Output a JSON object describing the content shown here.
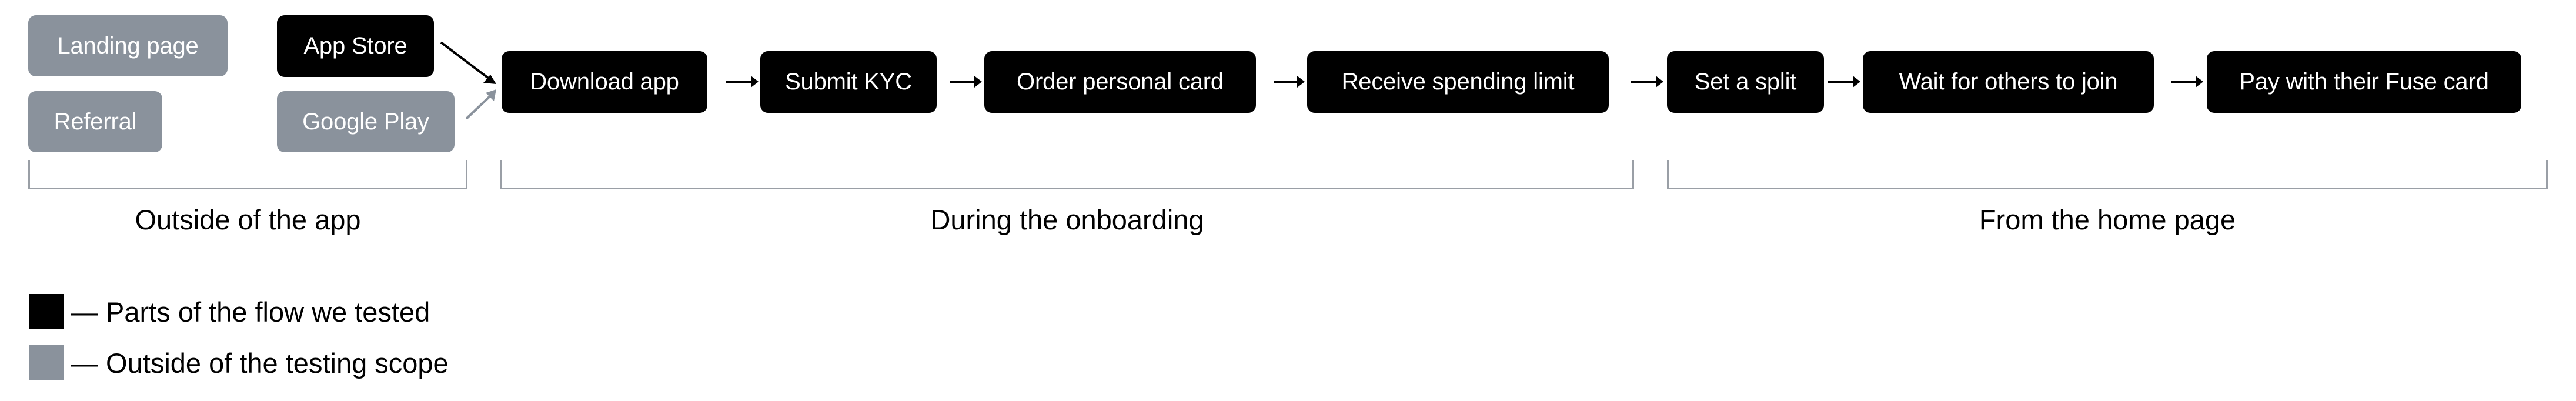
{
  "diagram": {
    "colors": {
      "tested": "#000000",
      "outside": "#8a929c",
      "bracket": "#9a9fa6",
      "text_on_node": "#ffffff"
    },
    "sources": {
      "entry_points": [
        {
          "label": "Landing page",
          "status": "outside"
        },
        {
          "label": "Referral",
          "status": "outside"
        }
      ],
      "stores": [
        {
          "label": "App Store",
          "status": "tested"
        },
        {
          "label": "Google Play",
          "status": "outside"
        }
      ]
    },
    "flow": [
      {
        "label": "Download app",
        "status": "tested"
      },
      {
        "label": "Submit KYC",
        "status": "tested"
      },
      {
        "label": "Order personal card",
        "status": "tested"
      },
      {
        "label": "Receive spending limit",
        "status": "tested"
      },
      {
        "label": "Set a split",
        "status": "tested"
      },
      {
        "label": "Wait for others to join",
        "status": "tested"
      },
      {
        "label": "Pay with their Fuse card",
        "status": "tested"
      }
    ],
    "connections": [
      {
        "from": "App Store",
        "to": "Download app",
        "status": "tested"
      },
      {
        "from": "Google Play",
        "to": "Download app",
        "status": "outside"
      },
      {
        "from": "Download app",
        "to": "Submit KYC",
        "status": "tested"
      },
      {
        "from": "Submit KYC",
        "to": "Order personal card",
        "status": "tested"
      },
      {
        "from": "Order personal card",
        "to": "Receive spending limit",
        "status": "tested"
      },
      {
        "from": "Receive spending limit",
        "to": "Set a split",
        "status": "tested"
      },
      {
        "from": "Set a split",
        "to": "Wait for others to join",
        "status": "tested"
      },
      {
        "from": "Wait for others to join",
        "to": "Pay with their Fuse card",
        "status": "tested"
      }
    ],
    "sections": [
      {
        "label": "Outside of the app"
      },
      {
        "label": "During the onboarding"
      },
      {
        "label": "From the home page"
      }
    ],
    "legend": [
      {
        "text": "— Parts of the flow we tested",
        "status": "tested"
      },
      {
        "text": "— Outside of the testing scope",
        "status": "outside"
      }
    ]
  }
}
